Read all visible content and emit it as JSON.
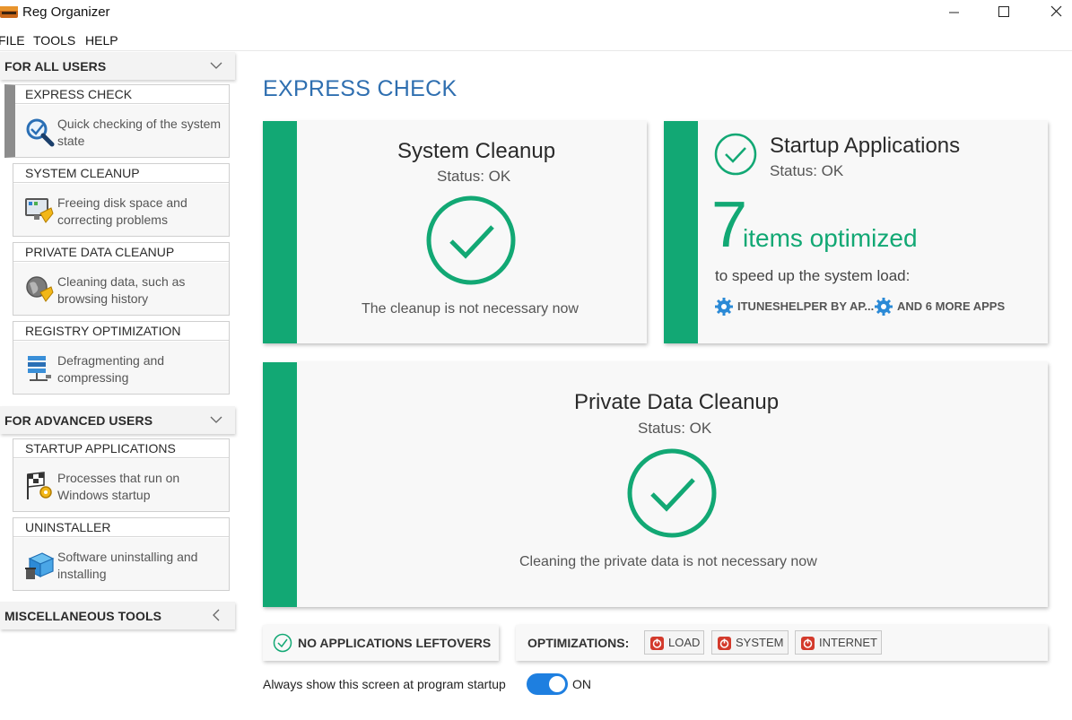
{
  "window": {
    "title": "Reg Organizer"
  },
  "menu": [
    "FILE",
    "TOOLS",
    "HELP"
  ],
  "sidebar": {
    "groups": [
      {
        "label": "FOR ALL USERS",
        "items": [
          {
            "title": "EXPRESS CHECK",
            "desc": "Quick checking of the system state"
          },
          {
            "title": "SYSTEM CLEANUP",
            "desc": "Freeing disk space and correcting problems"
          },
          {
            "title": "PRIVATE DATA CLEANUP",
            "desc": "Cleaning data, such as browsing history"
          },
          {
            "title": "REGISTRY OPTIMIZATION",
            "desc": "Defragmenting and compressing"
          }
        ]
      },
      {
        "label": "FOR ADVANCED USERS",
        "items": [
          {
            "title": "STARTUP APPLICATIONS",
            "desc": "Processes that run on Windows startup"
          },
          {
            "title": "UNINSTALLER",
            "desc": "Software uninstalling and installing"
          }
        ]
      },
      {
        "label": "MISCELLANEOUS TOOLS",
        "items": []
      }
    ]
  },
  "main": {
    "title": "EXPRESS CHECK",
    "system_cleanup": {
      "title": "System Cleanup",
      "status": "Status: OK",
      "message": "The cleanup is not necessary now"
    },
    "startup": {
      "title": "Startup Applications",
      "status": "Status: OK",
      "count": "7",
      "count_label": "items optimized",
      "subtitle": "to speed up the system load:",
      "apps": [
        "ITUNESHELPER BY AP...",
        "AND 6 MORE APPS"
      ]
    },
    "private_data": {
      "title": "Private Data Cleanup",
      "status": "Status: OK",
      "message": "Cleaning the private data is not necessary now"
    },
    "leftovers": "NO APPLICATIONS LEFTOVERS",
    "optimizations": {
      "label": "OPTIMIZATIONS:",
      "buttons": [
        "LOAD",
        "SYSTEM",
        "INTERNET"
      ]
    },
    "startup_note": "Always show this screen at program startup",
    "toggle_label": "ON"
  },
  "colors": {
    "accent_green": "#12a874",
    "title_blue": "#2f6fb0",
    "toggle_blue": "#1e7fe0",
    "power_red": "#d33a2c"
  }
}
